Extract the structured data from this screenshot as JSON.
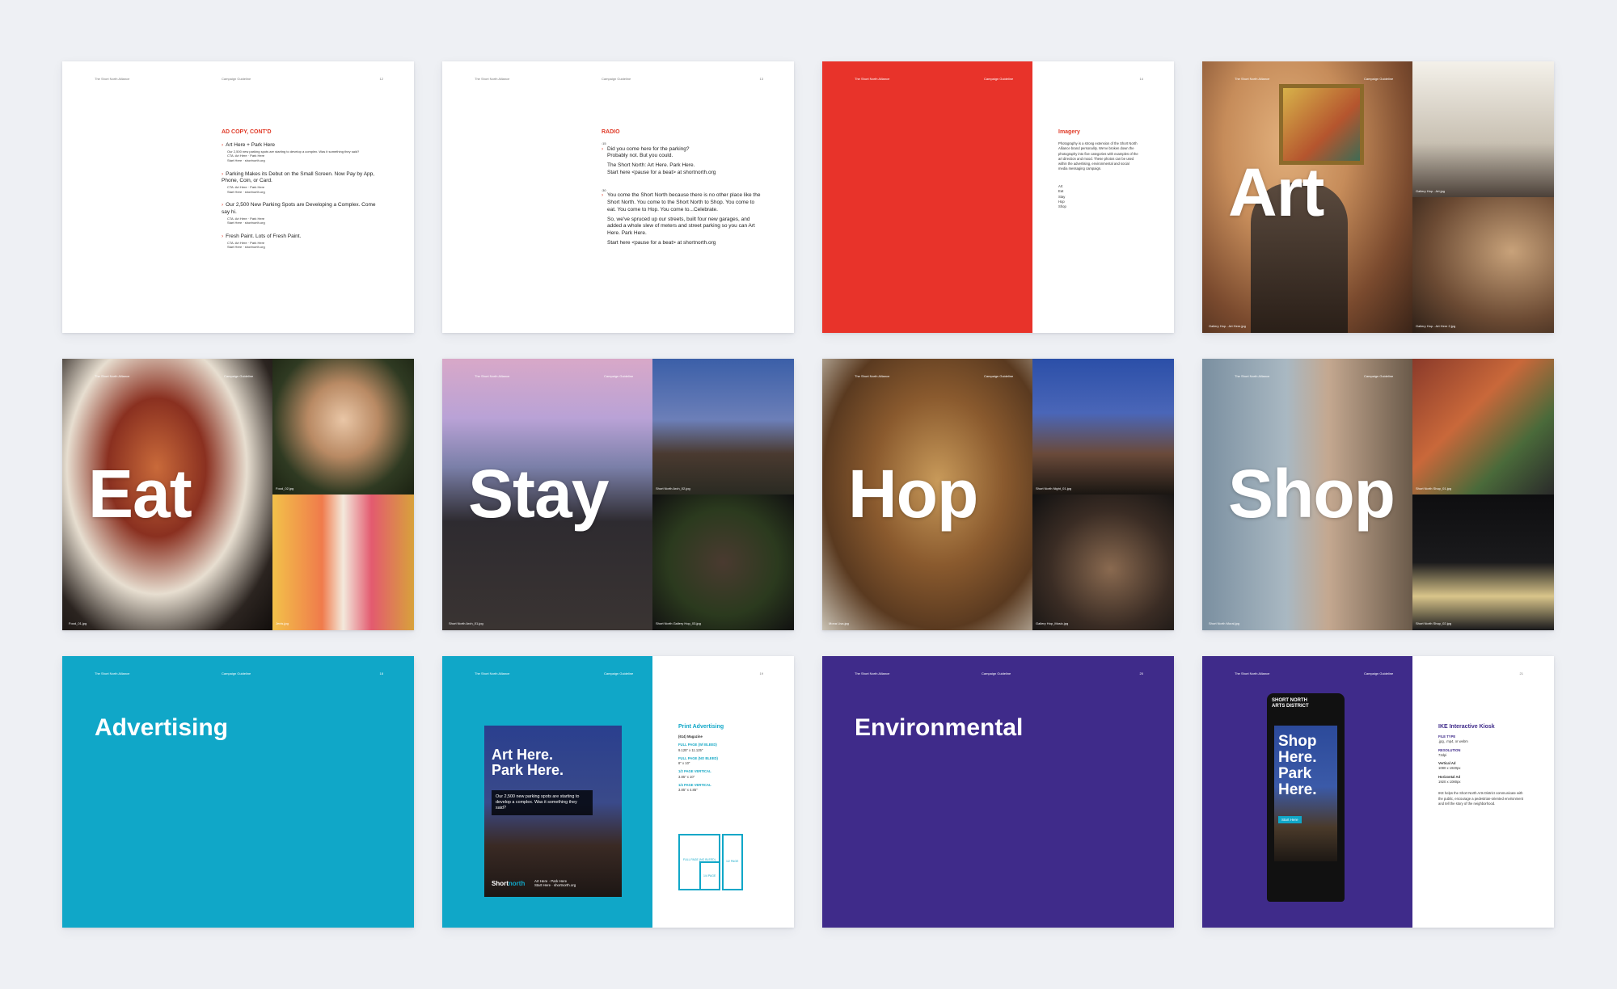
{
  "header": {
    "left": "The Short North Alliance",
    "middle": "Campaign Guideline"
  },
  "pages": {
    "adcopy": {
      "number": "12",
      "title": "AD COPY, CONT'D",
      "items": [
        {
          "headline": "Art Here + Park Here",
          "body": "Our 2,500 new parking spots are starting to develop a complex. Was it something they said?",
          "cta": "CTA: Art Here · Park Here\nStart Here · shortnorth.org"
        },
        {
          "headline": "Parking Makes its Debut on the Small Screen. Now Pay by App, Phone, Coin, or Card.",
          "body": "",
          "cta": "CTA: Art Here · Park Here\nStart Here · shortnorth.org"
        },
        {
          "headline": "Our 2,500 New Parking Spots are Developing a Complex. Come say hi.",
          "body": "",
          "cta": "CTA: Art Here · Park Here\nStart Here · shortnorth.org"
        },
        {
          "headline": "Fresh Paint. Lots of Fresh Paint.",
          "body": "",
          "cta": "CTA: Art Here · Park Here\nStart Here · shortnorth.org"
        }
      ]
    },
    "radio": {
      "number": "13",
      "title": "RADIO",
      "spot1_label": ":15",
      "spot1": [
        "Did you come here for the parking?",
        "Probably not. But you could.",
        "The Short North: Art Here. Park Here.",
        "Start here <pause for a beat> at shortnorth.org"
      ],
      "spot2_label": ":30",
      "spot2": [
        "You come the Short North because there is no other place like the Short North. You come to the Short North to Shop. You come to eat. You come to Hop. You come to...Celebrate.",
        "So, we've spruced up our streets, built four new garages, and added a whole slew of meters and street parking so you can Art Here. Park Here.",
        "Start here <pause for a beat> at shortnorth.org"
      ]
    },
    "imagery": {
      "number": "14",
      "title": "Imagery",
      "body": "Photography is a strong extension of the Short North Alliance brand personality. We've broken down the photography into five categories with examples of the art direction and mood. These photos can be used within the advertising, environmental and social media messaging campaign.",
      "list": [
        "Art",
        "Eat",
        "Stay",
        "Hop",
        "Shop"
      ]
    },
    "art": {
      "word": "Art",
      "caps": [
        "Gallery Hop - Art Here.jpg",
        "Gallery Hop - Art.jpg",
        "Gallery Hop - Art Here 2.jpg"
      ]
    },
    "eat": {
      "word": "Eat",
      "caps": [
        "Food_01.jpg",
        "Food_02.jpg",
        "Jenis.jpg"
      ]
    },
    "stay": {
      "word": "Stay",
      "caps": [
        "Short North Arch_01.jpg",
        "Short North Arch_02.jpg",
        "Short North Gallery Hop_03.jpg"
      ]
    },
    "hop": {
      "word": "Hop",
      "caps": [
        "Mona Lisa.jpg",
        "Short North Night_01.jpg",
        "Gallery Hop_Music.jpg"
      ]
    },
    "shop": {
      "word": "Shop",
      "caps": [
        "Short North Mural.jpg",
        "Short North Shop_01.jpg",
        "Short North Shop_02.jpg"
      ]
    },
    "advertising": {
      "number": "18",
      "title": "Advertising"
    },
    "print": {
      "number": "19",
      "ad_headline_1": "Art Here.",
      "ad_headline_2": "Park Here.",
      "ad_sub": "Our 2,500 new parking spots are starting to develop a complex. Was it something they said?",
      "ad_brand_1": "Short",
      "ad_brand_2": "north",
      "ad_cta": "Art Here · Park Here\nStart Here · shortnorth.org",
      "title": "Print Advertising",
      "pub": "(614) Magazine",
      "specs": [
        {
          "label": "FULL PAGE (W/ BLEED)",
          "value": "9.125\" x 11.125\""
        },
        {
          "label": "FULL PAGE (NO BLEED)",
          "value": "8\" x 10\""
        },
        {
          "label": "1/2 PAGE VERTICAL",
          "value": "3.85\" x 10\""
        },
        {
          "label": "1/4 PAGE VERTICAL",
          "value": "3.85\" x 4.85\""
        }
      ],
      "diagram": {
        "full": "FULL PAGE (NO BLEED)",
        "half": "1/2 PAGE",
        "quarter": "1/4 PAGE"
      }
    },
    "environmental": {
      "number": "20",
      "title": "Environmental"
    },
    "kiosk": {
      "number": "21",
      "kiosk_top": "SHORT NORTH\nARTS DISTRICT",
      "kiosk_lines": [
        "Shop",
        "Here.",
        "Park",
        "Here."
      ],
      "kiosk_button": "Start Here",
      "title": "IKE Interactive Kiosk",
      "specs": [
        {
          "label": "FILE TYPE",
          "value": ".jpg, .mp4, or webm"
        },
        {
          "label": "RESOLUTION",
          "value": "72dpi"
        },
        {
          "label": "Vertical Ad",
          "value": "1080 x 1920px"
        },
        {
          "label": "Horizontal Ad",
          "value": "1920 x 1080px"
        }
      ],
      "body": "IKE helps the Short North Arts District communicate with the public, encourage a pedestrian-oriented environment and tell the story of the neighborhood."
    }
  },
  "colors": {
    "red": "#e8332a",
    "teal": "#10a7c8",
    "purple": "#3f2b8a"
  }
}
